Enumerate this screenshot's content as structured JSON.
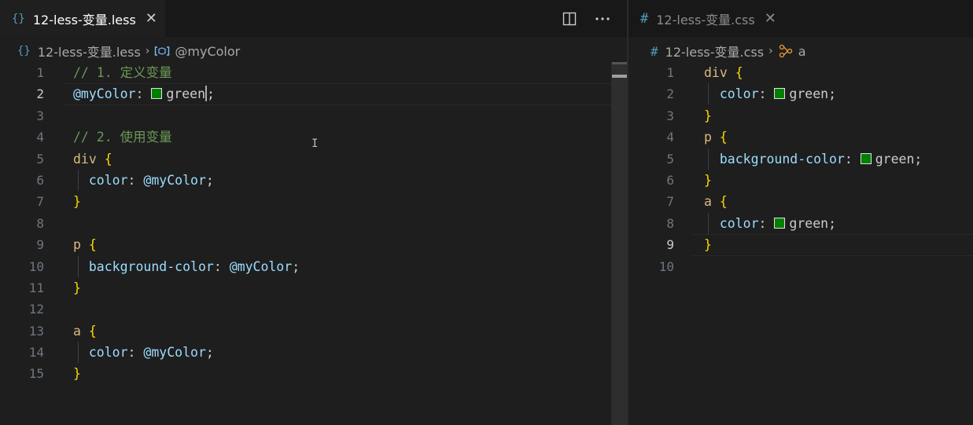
{
  "left": {
    "tab": {
      "icon": "{}",
      "title": "12-less-变量.less",
      "close": "✕"
    },
    "actions": [
      "split-editor-icon",
      "more-actions-icon"
    ],
    "breadcrumb": {
      "file": "12-less-变量.less",
      "separator": "›",
      "symbol": "@myColor"
    },
    "lines": [
      {
        "n": "1",
        "text": "// 1. 定义变量"
      },
      {
        "n": "2",
        "a": "@myColor",
        "b": ": ",
        "c": "green",
        "d": ";"
      },
      {
        "n": "3"
      },
      {
        "n": "4",
        "text": "// 2. 使用变量"
      },
      {
        "n": "5",
        "sel": "div",
        "brace": " {"
      },
      {
        "n": "6",
        "prop": "color",
        "colon": ": ",
        "var": "@myColor",
        "semi": ";"
      },
      {
        "n": "7",
        "brace": "}"
      },
      {
        "n": "8"
      },
      {
        "n": "9",
        "sel": "p",
        "brace": " {"
      },
      {
        "n": "10",
        "prop": "background-color",
        "colon": ": ",
        "var": "@myColor",
        "semi": ";"
      },
      {
        "n": "11",
        "brace": "}"
      },
      {
        "n": "12"
      },
      {
        "n": "13",
        "sel": "a",
        "brace": " {"
      },
      {
        "n": "14",
        "prop": "color",
        "colon": ": ",
        "var": "@myColor",
        "semi": ";"
      },
      {
        "n": "15",
        "brace": "}"
      }
    ]
  },
  "right": {
    "tab": {
      "icon": "#",
      "title": "12-less-变量.css",
      "close": "✕"
    },
    "breadcrumb": {
      "file": "12-less-变量.css",
      "separator": "›",
      "symbol": "a"
    },
    "lines": [
      {
        "n": "1",
        "sel": "div",
        "brace": " {"
      },
      {
        "n": "2",
        "prop": "color",
        "colon": ": ",
        "val": "green",
        "semi": ";"
      },
      {
        "n": "3",
        "brace": "}"
      },
      {
        "n": "4",
        "sel": "p",
        "brace": " {"
      },
      {
        "n": "5",
        "prop": "background-color",
        "colon": ": ",
        "val": "green",
        "semi": ";"
      },
      {
        "n": "6",
        "brace": "}"
      },
      {
        "n": "7",
        "sel": "a",
        "brace": " {"
      },
      {
        "n": "8",
        "prop": "color",
        "colon": ": ",
        "val": "green",
        "semi": ";"
      },
      {
        "n": "9",
        "brace": "}"
      },
      {
        "n": "10"
      }
    ]
  },
  "colors": {
    "swatch": "#008000",
    "background": "#1e1e1e",
    "comment": "#6a9955",
    "brace": "#ffd700"
  }
}
